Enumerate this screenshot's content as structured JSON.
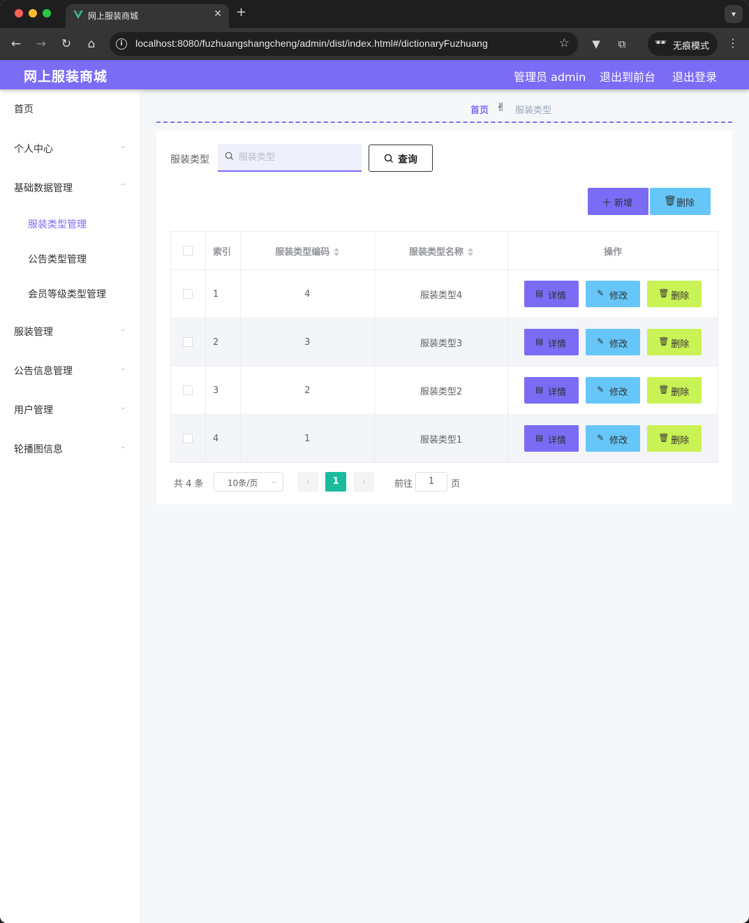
{
  "browser": {
    "tab_title": "网上服装商城",
    "tab_close": "✕",
    "new_tab": "+",
    "url": "localhost:8080/fuzhuangshangcheng/admin/dist/index.html#/dictionaryFuzhuang",
    "incognito_label": "无痕模式"
  },
  "header": {
    "brand": "网上服装商城",
    "admin_label": "管理员 admin",
    "to_front": "退出到前台",
    "logout": "退出登录"
  },
  "sidebar": {
    "items": [
      {
        "label": "首页"
      },
      {
        "label": "个人中心"
      },
      {
        "label": "基础数据管理"
      },
      {
        "label": "服装类型管理"
      },
      {
        "label": "公告类型管理"
      },
      {
        "label": "会员等级类型管理"
      },
      {
        "label": "服装管理"
      },
      {
        "label": "公告信息管理"
      },
      {
        "label": "用户管理"
      },
      {
        "label": "轮播图信息"
      }
    ]
  },
  "breadcrumb": {
    "home": "首页",
    "separator": "✌",
    "current": "服装类型"
  },
  "search": {
    "label": "服装类型",
    "placeholder": "服装类型",
    "query_label": "查询"
  },
  "actions": {
    "add_label": "新增",
    "delete_label": "删除"
  },
  "table": {
    "headers": [
      "索引",
      "服装类型编码",
      "服装类型名称",
      "操作"
    ],
    "rows": [
      {
        "index": "1",
        "code": "4",
        "name": "服装类型4"
      },
      {
        "index": "2",
        "code": "3",
        "name": "服装类型3"
      },
      {
        "index": "3",
        "code": "2",
        "name": "服装类型2"
      },
      {
        "index": "4",
        "code": "1",
        "name": "服装类型1"
      }
    ],
    "row_actions": {
      "detail": "详情",
      "edit": "修改",
      "delete": "删除"
    }
  },
  "pagination": {
    "total_text": "共 4 条",
    "page_size": "10条/页",
    "current_page": "1",
    "goto_label": "前往",
    "goto_value": "1",
    "page_suffix": "页"
  },
  "colors": {
    "accent": "#7a6cf5",
    "info": "#66c6f7",
    "danger": "#c9f255",
    "pager_active": "#1abc9c"
  }
}
